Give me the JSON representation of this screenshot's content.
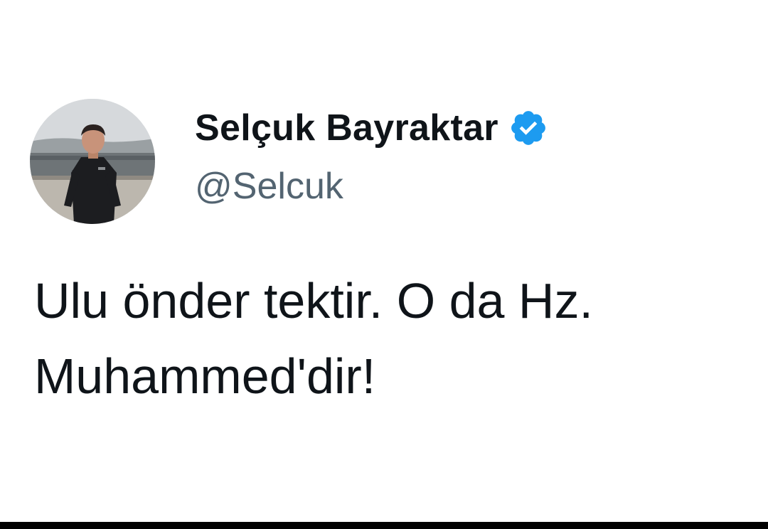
{
  "tweet": {
    "author": {
      "display_name": "Selçuk Bayraktar",
      "handle": "@Selcuk",
      "verified": true,
      "verified_icon": "verified-check-icon",
      "verified_color": "#1d9bf0"
    },
    "text_lines": [
      "Ulu önder tektir. O da Hz.",
      "Muhammed'dir!"
    ]
  },
  "colors": {
    "text_primary": "#0f1419",
    "text_secondary": "#536471",
    "background": "#ffffff"
  }
}
